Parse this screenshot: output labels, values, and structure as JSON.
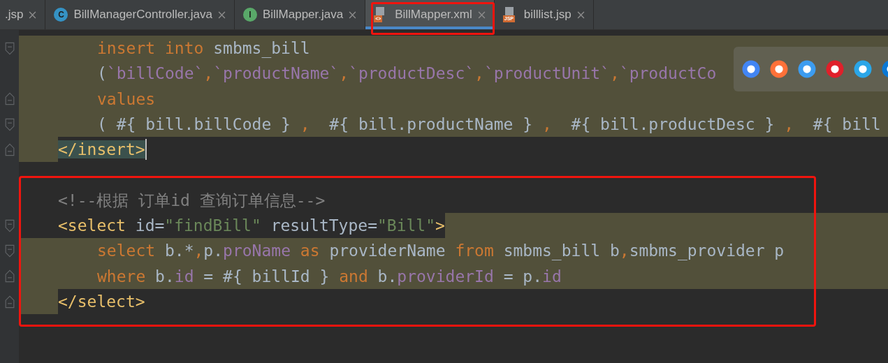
{
  "tabs": [
    {
      "label": ".jsp",
      "selected": false
    },
    {
      "label": "BillManagerController.java",
      "badge": "C",
      "kind": "class",
      "selected": false
    },
    {
      "label": "BillMapper.java",
      "badge": "I",
      "kind": "interface",
      "selected": false
    },
    {
      "label": "BillMapper.xml",
      "badge": "<>",
      "kind": "xml",
      "selected": true,
      "annotated": true
    },
    {
      "label": "billlist.jsp",
      "badge": "JSP",
      "kind": "jsp",
      "selected": false
    }
  ],
  "editor": {
    "blocks": [
      {
        "lines": [
          {
            "indented": true,
            "highlighted": true,
            "fold_start": true,
            "tokens": [
              {
                "text": "insert",
                "kind": "keyword"
              },
              {
                "text": " into",
                "kind": "keyword"
              },
              {
                "text": " smbms_bill",
                "kind": "plain"
              }
            ]
          },
          {
            "indented": true,
            "highlighted": true,
            "tokens": [
              {
                "text": "(",
                "kind": "plain"
              },
              {
                "text": "`billCode`",
                "kind": "field"
              },
              {
                "text": ",",
                "kind": "keyword"
              },
              {
                "text": "`productName`",
                "kind": "field"
              },
              {
                "text": ",",
                "kind": "keyword"
              },
              {
                "text": "`productDesc`",
                "kind": "field"
              },
              {
                "text": ",",
                "kind": "keyword"
              },
              {
                "text": "`productUnit`",
                "kind": "field"
              },
              {
                "text": ",",
                "kind": "keyword"
              },
              {
                "text": "`productCo",
                "kind": "field"
              }
            ]
          },
          {
            "indented": true,
            "highlighted": true,
            "fold_end": true,
            "tokens": [
              {
                "text": "values",
                "kind": "keyword"
              }
            ]
          },
          {
            "indented": true,
            "highlighted": true,
            "fold_start": true,
            "tokens": [
              {
                "text": "( #{ bill.billCode } ",
                "kind": "plain"
              },
              {
                "text": ",",
                "kind": "keyword"
              },
              {
                "text": "  #{ bill.productName } ",
                "kind": "plain"
              },
              {
                "text": ",",
                "kind": "keyword"
              },
              {
                "text": "  #{ bill.productDesc } ",
                "kind": "plain"
              },
              {
                "text": ",",
                "kind": "keyword"
              },
              {
                "text": "  #{ bill",
                "kind": "plain"
              }
            ]
          },
          {
            "indented": false,
            "margin_highlighted": true,
            "fold_end": true,
            "cursor": true,
            "tokens": [
              {
                "text": "</insert>",
                "kind": "tag",
                "matched": true
              }
            ]
          }
        ]
      },
      {
        "annotated": true,
        "lines": [
          {
            "indented": false,
            "tokens": [
              {
                "text": "<!--根据 订单id 查询订单信息-->",
                "kind": "comment"
              }
            ]
          },
          {
            "indented": false,
            "tail_highlighted": true,
            "fold_start": true,
            "tokens": [
              {
                "text": "<select",
                "kind": "tag"
              },
              {
                "text": " id=",
                "kind": "plain"
              },
              {
                "text": "\"findBill\"",
                "kind": "string"
              },
              {
                "text": " resultType=",
                "kind": "plain"
              },
              {
                "text": "\"Bill\"",
                "kind": "string"
              },
              {
                "text": ">",
                "kind": "tag"
              }
            ]
          },
          {
            "indented": true,
            "highlighted": true,
            "fold_start": true,
            "tokens": [
              {
                "text": "select",
                "kind": "keyword"
              },
              {
                "text": " b.*",
                "kind": "plain"
              },
              {
                "text": ",",
                "kind": "keyword"
              },
              {
                "text": "p.",
                "kind": "plain"
              },
              {
                "text": "proName",
                "kind": "field"
              },
              {
                "text": " as ",
                "kind": "keyword"
              },
              {
                "text": "providerName ",
                "kind": "plain"
              },
              {
                "text": "from",
                "kind": "keyword"
              },
              {
                "text": " smbms_bill b",
                "kind": "plain"
              },
              {
                "text": ",",
                "kind": "keyword"
              },
              {
                "text": "smbms_provider p",
                "kind": "plain"
              }
            ]
          },
          {
            "indented": true,
            "highlighted": true,
            "fold_end": true,
            "tokens": [
              {
                "text": "where",
                "kind": "keyword"
              },
              {
                "text": " b.",
                "kind": "plain"
              },
              {
                "text": "id",
                "kind": "field"
              },
              {
                "text": " = #{ billId } ",
                "kind": "plain"
              },
              {
                "text": "and",
                "kind": "keyword"
              },
              {
                "text": " b.",
                "kind": "plain"
              },
              {
                "text": "providerId",
                "kind": "field"
              },
              {
                "text": " = p.",
                "kind": "plain"
              },
              {
                "text": "id",
                "kind": "field"
              }
            ]
          },
          {
            "indented": false,
            "margin_highlighted": true,
            "fold_end": true,
            "tokens": [
              {
                "text": "</select>",
                "kind": "tag"
              }
            ]
          }
        ]
      }
    ]
  }
}
